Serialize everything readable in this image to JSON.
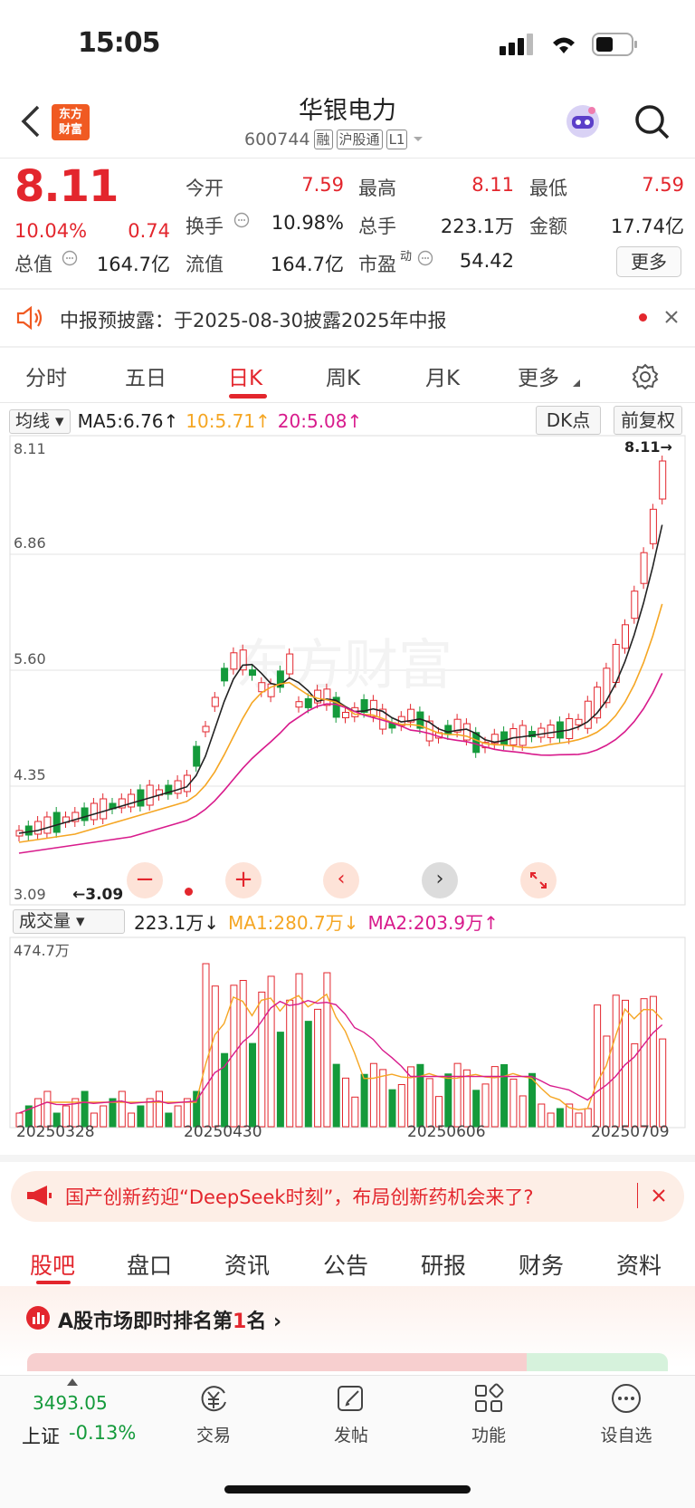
{
  "status": {
    "time": "15:05"
  },
  "header": {
    "title": "华银电力",
    "code": "600744",
    "tags": [
      "融",
      "沪股通",
      "L1"
    ],
    "logo_text": [
      "东方",
      "财富"
    ]
  },
  "quote": {
    "price": "8.11",
    "change_pct": "10.04%",
    "change": "0.74",
    "open_label": "今开",
    "open": "7.59",
    "high_label": "最高",
    "high": "8.11",
    "low_label": "最低",
    "low": "7.59",
    "turnover_label": "换手",
    "turnover": "10.98%",
    "volume_label": "总手",
    "volume": "223.1万",
    "amount_label": "金额",
    "amount": "17.74亿",
    "mcap_label": "总值",
    "mcap": "164.7亿",
    "float_label": "流值",
    "float": "164.7亿",
    "pe_label": "市盈",
    "pe_sup": "动",
    "pe": "54.42",
    "more_label": "更多"
  },
  "notice": {
    "text": "中报预披露：于2025-08-30披露2025年中报"
  },
  "tabs": [
    "分时",
    "五日",
    "日K",
    "周K",
    "月K",
    "更多"
  ],
  "kline": {
    "ma_select": "均线",
    "ma5": "MA5:6.76↑",
    "ma10": "10:5.71↑",
    "ma20": "20:5.08↑",
    "dk_label": "DK点",
    "adjust_label": "前复权",
    "y_labels": [
      "8.11",
      "6.86",
      "5.60",
      "4.35",
      "3.09"
    ],
    "last_mark": "8.11→",
    "low_mark": "←3.09",
    "colors": {
      "up": "#e3262d",
      "down": "#149a3b",
      "ma5": "#222222",
      "ma10": "#f5a623",
      "ma20": "#d81b8c"
    }
  },
  "volume": {
    "select": "成交量",
    "value": "223.1万↓",
    "ma1": "MA1:280.7万↓",
    "ma2": "MA2:203.9万↑",
    "max_label": "474.7万",
    "dates": [
      "20250328",
      "20250430",
      "20250606",
      "20250709"
    ]
  },
  "banner": {
    "text": "国产创新药迎“DeepSeek时刻”，布局创新药机会来了?"
  },
  "bottom_tabs": [
    "股吧",
    "盘口",
    "资讯",
    "公告",
    "研报",
    "财务",
    "资料"
  ],
  "rank": {
    "text_a": "A股市场即时排名第",
    "rank_num": "1",
    "text_b": "名"
  },
  "bottom_bar": {
    "index_value": "3493.05",
    "index_name": "上证",
    "index_change": "-0.13%",
    "items": [
      "交易",
      "发帖",
      "功能",
      "设自选"
    ]
  },
  "chart_data": {
    "type": "candlestick",
    "ylim": [
      3.09,
      8.11
    ],
    "series": [
      {
        "name": "MA5",
        "values": []
      },
      {
        "name": "MA10",
        "values": []
      },
      {
        "name": "MA20",
        "values": []
      }
    ]
  }
}
